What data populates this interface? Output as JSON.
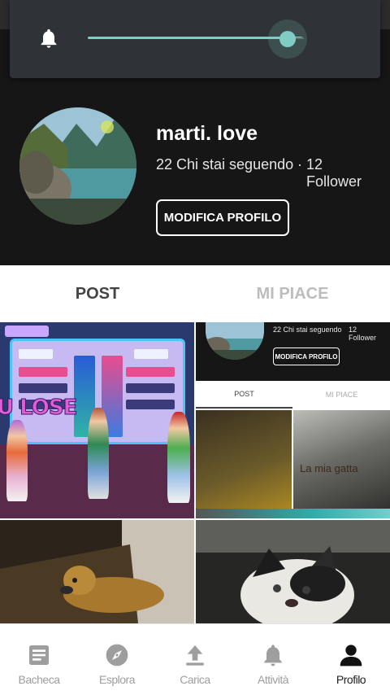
{
  "volume": {
    "icon": "bell-icon",
    "level": 0.93,
    "accent": "#80cbc4"
  },
  "profile": {
    "name": "marti. love",
    "following_text": "22 Chi stai seguendo",
    "separator": "·",
    "followers_count": "12",
    "followers_label": "Follower",
    "edit_button": "MODIFICA PROFILO"
  },
  "tabs": [
    {
      "label": "POST",
      "active": true
    },
    {
      "label": "MI PIACE",
      "active": false
    }
  ],
  "grid": {
    "game_lose_text": "U LOSE",
    "mini_screenshot": {
      "following_text": "22 Chi stai seguendo",
      "separator": "·",
      "followers_count": "12",
      "followers_label": "Follower",
      "edit_button": "MODIFICA PROFILO",
      "tab_post": "POST",
      "tab_like": "MI PIACE",
      "photo_caption": "La mia gatta"
    }
  },
  "bottom_nav": [
    {
      "label": "Bacheca",
      "icon": "feed-icon",
      "active": false
    },
    {
      "label": "Esplora",
      "icon": "compass-icon",
      "active": false
    },
    {
      "label": "Carica",
      "icon": "upload-icon",
      "active": false
    },
    {
      "label": "Attività",
      "icon": "bell-icon",
      "active": false
    },
    {
      "label": "Profilo",
      "icon": "person-icon",
      "active": true
    }
  ],
  "colors": {
    "header_bg": "#161616",
    "active_text": "#222222",
    "inactive_text": "#9e9e9e"
  }
}
